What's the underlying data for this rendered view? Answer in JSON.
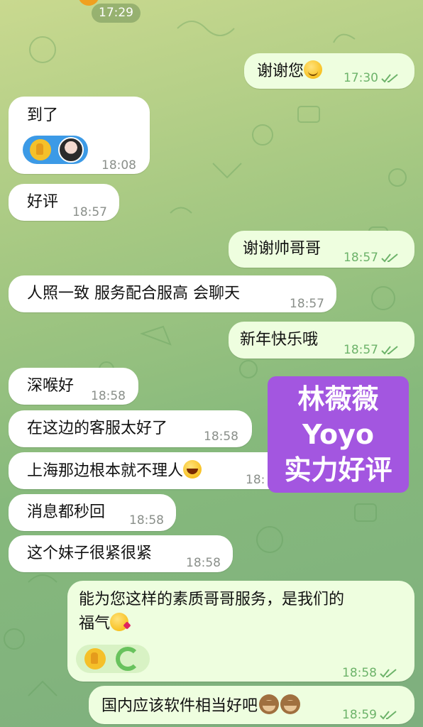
{
  "header": {
    "date_time": "17:29"
  },
  "messages": [
    {
      "id": "m1",
      "dir": "out",
      "text": "谢谢您",
      "emoji": "smiling-face",
      "time": "17:30",
      "read": true
    },
    {
      "id": "m2",
      "dir": "in",
      "text": "到了",
      "time": "18:08",
      "reactions": [
        "thumbs-up",
        "avatar"
      ]
    },
    {
      "id": "m3",
      "dir": "in",
      "text": "好评",
      "time": "18:57"
    },
    {
      "id": "m4",
      "dir": "out",
      "text": "谢谢帅哥哥",
      "time": "18:57",
      "read": true
    },
    {
      "id": "m5",
      "dir": "in",
      "text": "人照一致 服务配合服高 会聊天",
      "time": "18:57"
    },
    {
      "id": "m6",
      "dir": "out",
      "text": "新年快乐哦",
      "time": "18:57",
      "read": true
    },
    {
      "id": "m7",
      "dir": "in",
      "text": "深喉好",
      "time": "18:58"
    },
    {
      "id": "m8",
      "dir": "in",
      "text": "在这边的客服太好了",
      "time": "18:58"
    },
    {
      "id": "m9",
      "dir": "in",
      "text": "上海那边根本就不理人",
      "emoji": "face-with-tears-of-joy",
      "time": "18:"
    },
    {
      "id": "m10",
      "dir": "in",
      "text": "消息都秒回",
      "time": "18:58"
    },
    {
      "id": "m11",
      "dir": "in",
      "text": "这个妹子很紧很紧",
      "time": "18:58"
    },
    {
      "id": "m12",
      "dir": "out",
      "line1": "能为您这样的素质哥哥服务，是我们的",
      "line2": "福气",
      "emoji": "face-blowing-kiss",
      "time": "18:58",
      "read": true,
      "reactions": [
        "thumbs-up",
        "loading"
      ]
    },
    {
      "id": "m13",
      "dir": "out",
      "text": "国内应该软件相当好吧",
      "emoji": "see-no-evil-monkey",
      "time": "18:59",
      "read": true
    }
  ],
  "overlay": {
    "line1": "林薇薇",
    "line2": "Yoyo",
    "line3": "实力好评",
    "background": "#a356e0"
  },
  "colors": {
    "incoming": "#ffffff",
    "outgoing": "#eefedf",
    "time_in": "#8a8f8a",
    "time_out": "#6db36a"
  }
}
